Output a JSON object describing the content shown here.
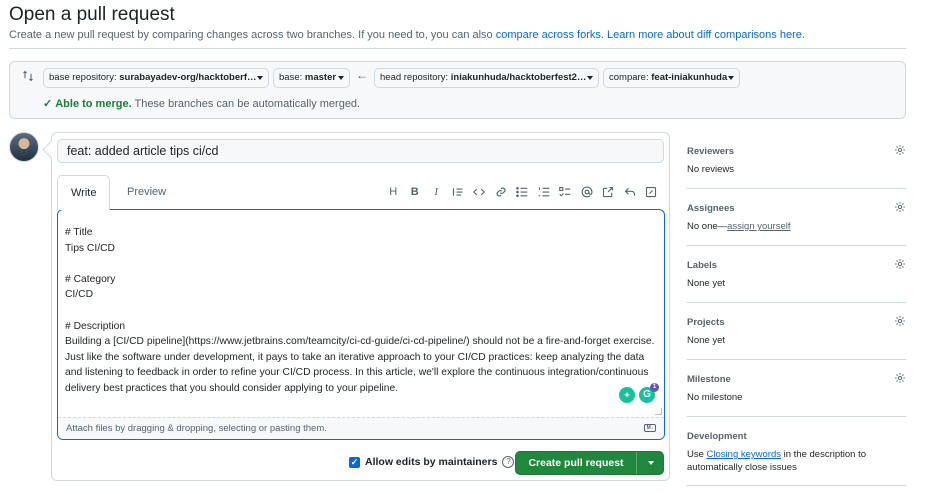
{
  "header": {
    "title": "Open a pull request",
    "subtitle_text": "Create a new pull request by comparing changes across two branches. If you need to, you can also ",
    "compare_forks_link": "compare across forks.",
    "learn_more_link": "Learn more about diff comparisons here."
  },
  "compare": {
    "base_repo_label": "base repository: ",
    "base_repo_value": "surabayadev-org/hacktoberf…",
    "base_label": "base: ",
    "base_value": "master",
    "head_repo_label": "head repository: ",
    "head_repo_value": "iniakunhuda/hacktoberfest2…",
    "compare_label": "compare: ",
    "compare_value": "feat-iniakunhuda",
    "merge_ok": "Able to merge.",
    "merge_desc": " These branches can be automatically merged."
  },
  "editor": {
    "title_value": "feat: added article tips ci/cd",
    "tab_write": "Write",
    "tab_preview": "Preview",
    "body": "# Title\nTips CI/CD\n\n# Category\nCI/CD\n\n# Description\nBuilding a [CI/CD pipeline](https://www.jetbrains.com/teamcity/ci-cd-guide/ci-cd-pipeline/) should not be a fire-and-forget exercise. Just like the software under development, it pays to take an iterative approach to your CI/CD practices: keep analyzing the data and listening to feedback in order to refine your CI/CD process. In this article, we'll explore the continuous integration/continuous delivery best practices that you should consider applying to your pipeline.",
    "attach_text": "Attach files by dragging & dropping, selecting or pasting them.",
    "grammarly_count": "1",
    "toolbar": [
      "H",
      "B",
      "I"
    ]
  },
  "footer": {
    "allow_edits": "Allow edits by maintainers",
    "create_button": "Create pull request"
  },
  "sidebar": {
    "reviewers": {
      "heading": "Reviewers",
      "value": "No reviews"
    },
    "assignees": {
      "heading": "Assignees",
      "value_prefix": "No one—",
      "value_link": "assign yourself"
    },
    "labels": {
      "heading": "Labels",
      "value": "None yet"
    },
    "projects": {
      "heading": "Projects",
      "value": "None yet"
    },
    "milestone": {
      "heading": "Milestone",
      "value": "No milestone"
    },
    "development": {
      "heading": "Development",
      "value_prefix": "Use ",
      "value_link": "Closing keywords",
      "value_suffix": " in the description to",
      "value_line2": "automatically close issues"
    }
  },
  "colors": {
    "accent": "#0969da",
    "success": "#1a7f37",
    "primary_button": "#1f883d",
    "border": "#d1d9e0",
    "muted_text": "#59636e"
  }
}
